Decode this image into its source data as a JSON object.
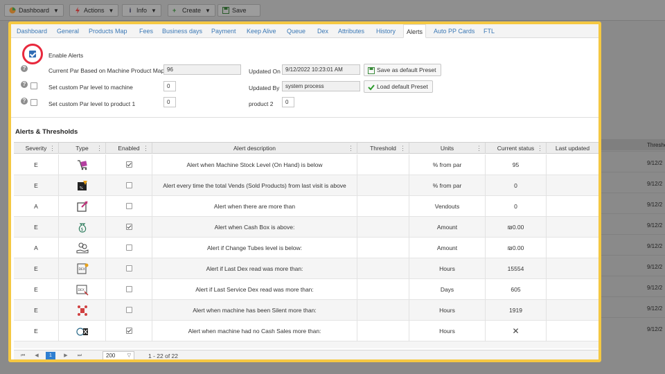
{
  "toolbar": {
    "buttons": [
      {
        "label": "Dashboard",
        "icon": "pie-chart-icon",
        "caret": true
      },
      {
        "label": "Actions",
        "icon": "bolt-icon",
        "caret": true
      },
      {
        "label": "Info",
        "icon": "info-icon",
        "caret": true
      },
      {
        "label": "Create",
        "icon": "plus-icon",
        "caret": true
      },
      {
        "label": "Save",
        "icon": "save-icon",
        "caret": false
      }
    ]
  },
  "tabs": [
    "Dashboard",
    "General",
    "Products Map",
    "Fees",
    "Business days",
    "Payment",
    "Keep Alive",
    "Queue",
    "Dex",
    "Attributes",
    "History",
    "Alerts",
    "Auto PP Cards",
    "FTL"
  ],
  "active_tab": "Alerts",
  "settings": {
    "enable_alerts_label": "Enable Alerts",
    "current_par_label": "Current Par Based on Machine Product Map:",
    "current_par_value": "96",
    "custom_par_machine_label": "Set custom Par level to machine",
    "custom_par_machine_value": "0",
    "custom_par_product_label": "Set custom Par level to product 1",
    "custom_par_product_value": "0",
    "updated_on_label": "Updated On",
    "updated_on_value": "9/12/2022 10:23:01 AM",
    "updated_by_label": "Updated By",
    "updated_by_value": "system process",
    "product2_label": "product 2",
    "product2_value": "0",
    "save_preset_label": "Save as default Preset",
    "load_preset_label": "Load default Preset"
  },
  "section_title": "Alerts & Thresholds",
  "grid": {
    "columns": [
      "Severity",
      "Type",
      "Enabled",
      "Alert description",
      "Threshold",
      "Units",
      "Current status",
      "Last updated",
      "Threshold"
    ],
    "rows": [
      {
        "severity": "E",
        "type_icon": "cart-icon",
        "enabled": true,
        "description": "Alert when Machine Stock Level (On Hand) is below",
        "threshold": "",
        "units": "% from par",
        "status": "95",
        "last": "9/12/2"
      },
      {
        "severity": "E",
        "type_icon": "vends-icon",
        "enabled": false,
        "description": "Alert every time the total Vends (Sold Products) from last visit is above",
        "threshold": "",
        "units": "% from par",
        "status": "0",
        "last": "9/12/2"
      },
      {
        "severity": "A",
        "type_icon": "vendout-icon",
        "enabled": false,
        "description": "Alert when there are more than",
        "threshold": "",
        "units": "Vendouts",
        "status": "0",
        "last": "9/12/2"
      },
      {
        "severity": "E",
        "type_icon": "money-bag-icon",
        "enabled": true,
        "description": "Alert when Cash Box is above:",
        "threshold": "",
        "units": "Amount",
        "status": "₪0.00",
        "last": "9/12/2"
      },
      {
        "severity": "A",
        "type_icon": "coin-hand-icon",
        "enabled": false,
        "description": "Alert if Change Tubes level is below:",
        "threshold": "",
        "units": "Amount",
        "status": "₪0.00",
        "last": "9/12/2"
      },
      {
        "severity": "E",
        "type_icon": "dex-read-icon",
        "enabled": false,
        "description": "Alert if Last Dex read was more than:",
        "threshold": "",
        "units": "Hours",
        "status": "15554",
        "last": "9/12/2"
      },
      {
        "severity": "E",
        "type_icon": "service-dex-icon",
        "enabled": false,
        "description": "Alert if Last Service Dex read was more than:",
        "threshold": "",
        "units": "Days",
        "status": "605",
        "last": "9/12/2"
      },
      {
        "severity": "E",
        "type_icon": "silent-machine-icon",
        "enabled": false,
        "description": "Alert when machine has been Silent more than:",
        "threshold": "",
        "units": "Hours",
        "status": "1919",
        "last": "9/12/2"
      },
      {
        "severity": "E",
        "type_icon": "no-cash-icon",
        "enabled": true,
        "description": "Alert when machine had no Cash Sales more than:",
        "threshold": "",
        "units": "Hours",
        "status": "✕",
        "last": "9/12/2"
      }
    ]
  },
  "pager": {
    "current_page": "1",
    "page_size": "200",
    "info": "1 - 22 of 22"
  },
  "colors": {
    "highlight_border": "#f5c842",
    "focus_ring": "#e8283c",
    "accent": "#2f6db5",
    "link": "#3b78b5"
  }
}
